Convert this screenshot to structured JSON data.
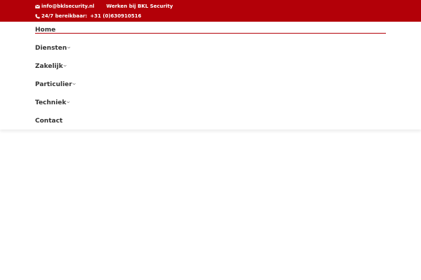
{
  "topbar": {
    "email": "info@bklsecurity.nl",
    "careers_link": "Werken bij BKL Security",
    "availability_label": "24/7 bereikbaar:",
    "phone": "+31 (0)630910516",
    "background_color": "#b30008",
    "email_icon": "envelope-icon",
    "phone_icon": "phone-icon"
  },
  "nav": {
    "active_color": "#b30008",
    "items": [
      {
        "label": "Home",
        "has_submenu": false,
        "active": true
      },
      {
        "label": "Diensten",
        "has_submenu": true
      },
      {
        "label": "Zakelijk",
        "has_submenu": true
      },
      {
        "label": "Particulier",
        "has_submenu": true
      },
      {
        "label": "Techniek",
        "has_submenu": true
      },
      {
        "label": "Contact",
        "has_submenu": false
      }
    ]
  }
}
